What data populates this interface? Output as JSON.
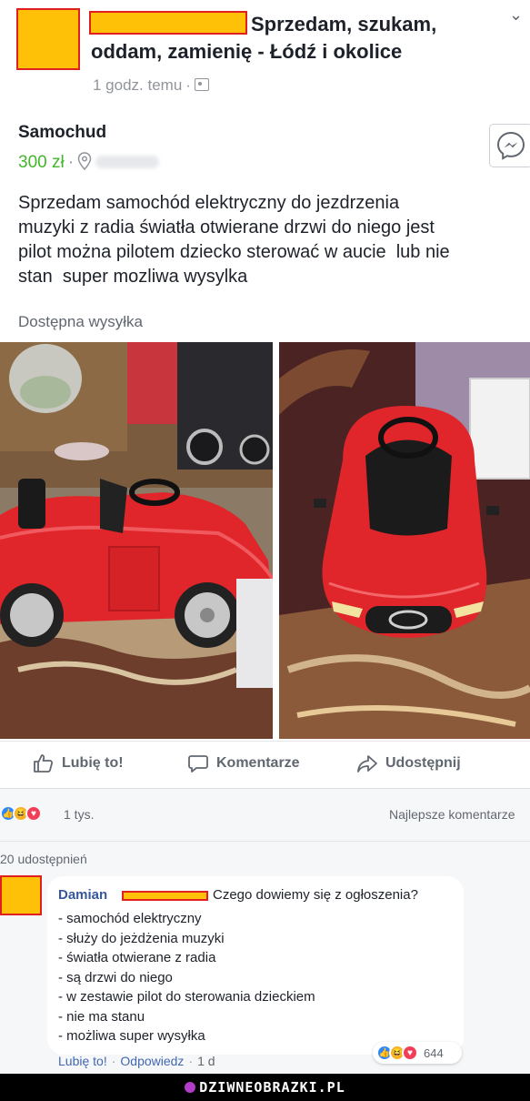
{
  "post": {
    "group_title": "Sprzedam, szukam, oddam, zamienię - Łódź i okolice",
    "time": "1 godz. temu",
    "item_title": "Samochud",
    "price": "300 zł",
    "description": "Sprzedam samochód elektryczny do jezdrzenia\nmuzyki z radia światła otwierane drzwi do niego jest\npilot można pilotem dziecko sterować w aucie  lub nie\nstan  super mozliwa wysylka",
    "shipping": "Dostępna wysyłka"
  },
  "actions": {
    "like": "Lubię to!",
    "comment": "Komentarze",
    "share": "Udostępnij"
  },
  "stats": {
    "reactions_count": "1 tys.",
    "best_comments": "Najlepsze komentarze",
    "shares": "20 udostępnień"
  },
  "comment": {
    "author": "Damian",
    "headline": "Czego dowiemy się z ogłoszenia?",
    "lines": [
      "- samochód elektryczny",
      "- służy do jeżdżenia muzyki",
      "- światła otwierane z radia",
      "- są drzwi do niego",
      "- w zestawie pilot do sterowania dzieckiem",
      "- nie ma stanu",
      "- możliwa super wysyłka"
    ],
    "like": "Lubię to!",
    "reply": "Odpowiedz",
    "time": "1 d",
    "reactions_count": "644"
  },
  "footer": {
    "watermark": "DZIWNEOBRAZKI.PL"
  },
  "colors": {
    "price": "#42b72a",
    "link": "#365899",
    "redaction_fill": "#ffc107",
    "redaction_border": "#e02020",
    "car": "#e0262b"
  }
}
